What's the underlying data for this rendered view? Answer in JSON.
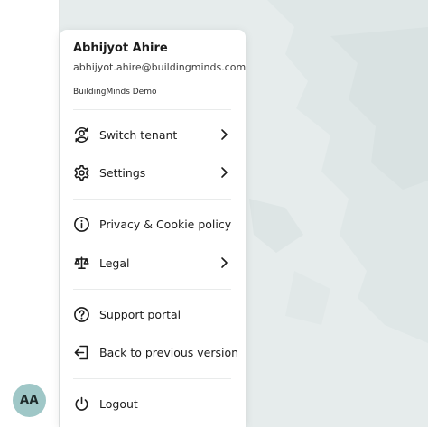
{
  "user": {
    "name": "Abhijyot Ahire",
    "email": "abhijyot.ahire@buildingminds.com",
    "tenant": "BuildingMinds Demo",
    "initials": "AA"
  },
  "menu": {
    "items": [
      {
        "label": "Switch tenant",
        "icon": "switch-user-icon",
        "has_submenu": true
      },
      {
        "label": "Settings",
        "icon": "gear-icon",
        "has_submenu": true
      },
      {
        "label": "Privacy & Cookie policy",
        "icon": "info-icon",
        "has_submenu": false
      },
      {
        "label": "Legal",
        "icon": "scale-icon",
        "has_submenu": true
      },
      {
        "label": "Support portal",
        "icon": "help-icon",
        "has_submenu": false
      },
      {
        "label": "Back to previous version",
        "icon": "exit-icon",
        "has_submenu": false
      },
      {
        "label": "Logout",
        "icon": "power-icon",
        "has_submenu": false
      }
    ]
  },
  "colors": {
    "avatar_bg": "#9fc7c7",
    "map_bg": "#e6ecec",
    "menu_bg": "#ffffff"
  }
}
